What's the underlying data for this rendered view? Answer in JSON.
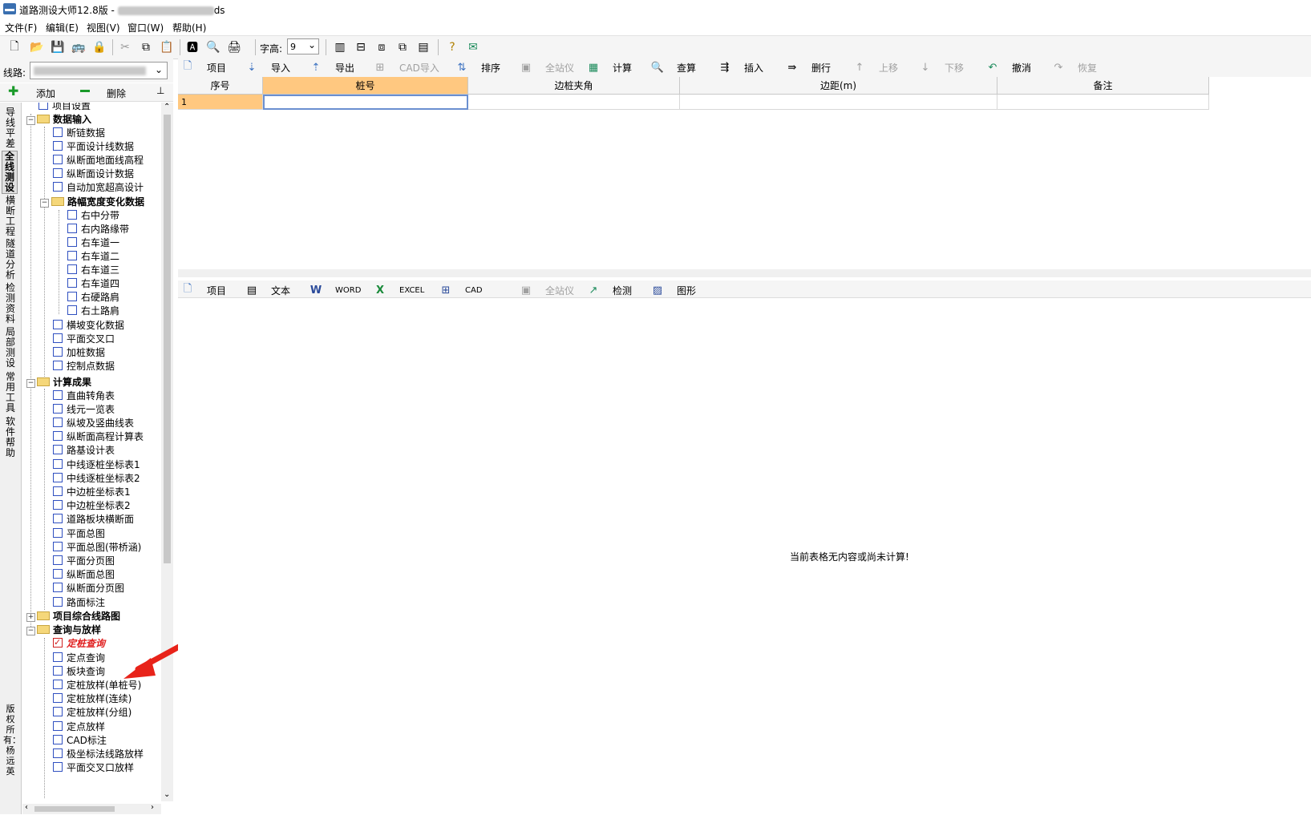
{
  "window": {
    "title": "道路测设大师12.8版 - ",
    "title_suffix": "ds"
  },
  "menu": [
    "文件(F)",
    "编辑(E)",
    "视图(V)",
    "窗口(W)",
    "帮助(H)"
  ],
  "toolbar": {
    "fontsize_label": "字高:",
    "fontsize_value": "9"
  },
  "route": {
    "label": "线路:"
  },
  "tree_actions": {
    "add": "添加",
    "delete": "删除"
  },
  "vtabs": [
    "导线平差",
    "全线测设",
    "横断工程",
    "隧道分析",
    "检测资料",
    "局部测设",
    "常用工具",
    "软件帮助",
    "版权所有：杨远英"
  ],
  "tree": {
    "project_settings": "项目设置",
    "data_input": {
      "label": "数据输入",
      "items": [
        "断链数据",
        "平面设计线数据",
        "纵断面地面线高程",
        "纵断面设计数据",
        "自动加宽超高设计"
      ]
    },
    "width_change": {
      "label": "路幅宽度变化数据",
      "items": [
        "右中分带",
        "右内路缘带",
        "右车道一",
        "右车道二",
        "右车道三",
        "右车道四",
        "右硬路肩",
        "右土路肩"
      ]
    },
    "data_input_more": [
      "横坡变化数据",
      "平面交叉口",
      "加桩数据",
      "控制点数据"
    ],
    "results": {
      "label": "计算成果",
      "items": [
        "直曲转角表",
        "线元一览表",
        "纵坡及竖曲线表",
        "纵断面高程计算表",
        "路基设计表",
        "中线逐桩坐标表1",
        "中线逐桩坐标表2",
        "中边桩坐标表1",
        "中边桩坐标表2",
        "道路板块横断面",
        "平面总图",
        "平面总图(带桥涵)",
        "平面分页图",
        "纵断面总图",
        "纵断面分页图",
        "路面标注"
      ]
    },
    "route_map": {
      "label": "项目综合线路图"
    },
    "query": {
      "label": "查询与放样",
      "selected": "定桩查询",
      "items": [
        "定点查询",
        "板块查询",
        "定桩放样(单桩号)",
        "定桩放样(连续)",
        "定桩放样(分组)",
        "定点放样",
        "CAD标注",
        "极坐标法线路放样",
        "平面交叉口放样"
      ]
    }
  },
  "grid_toolbar": [
    {
      "label": "项目",
      "icon": "doc-icon",
      "enabled": true
    },
    {
      "label": "导入",
      "icon": "import-icon",
      "enabled": true
    },
    {
      "label": "导出",
      "icon": "export-icon",
      "enabled": true
    },
    {
      "label": "CAD导入",
      "icon": "cad-icon",
      "enabled": false
    },
    {
      "label": "排序",
      "icon": "sort-icon",
      "enabled": true
    },
    {
      "label": "全站仪",
      "icon": "totalstation-icon",
      "enabled": false
    },
    {
      "label": "计算",
      "icon": "calc-icon",
      "enabled": true
    },
    {
      "label": "查算",
      "icon": "search-icon",
      "enabled": true
    },
    {
      "label": "插入",
      "icon": "insert-icon",
      "enabled": true
    },
    {
      "label": "删行",
      "icon": "delete-row-icon",
      "enabled": true
    },
    {
      "label": "上移",
      "icon": "up-arrow-icon",
      "enabled": false
    },
    {
      "label": "下移",
      "icon": "down-arrow-icon",
      "enabled": false
    },
    {
      "label": "撤消",
      "icon": "undo-icon",
      "enabled": true
    },
    {
      "label": "恢复",
      "icon": "redo-icon",
      "enabled": false
    }
  ],
  "grid": {
    "columns": [
      "序号",
      "桩号",
      "边桩夹角",
      "边距(m)",
      "备注"
    ],
    "rows": [
      [
        "1",
        "",
        "",
        "",
        ""
      ]
    ]
  },
  "result_toolbar": [
    {
      "label": "项目",
      "icon": "doc-icon",
      "enabled": true
    },
    {
      "label": "文本",
      "icon": "text-icon",
      "enabled": true
    },
    {
      "label": "WORD",
      "icon": "word-icon",
      "enabled": true
    },
    {
      "label": "EXCEL",
      "icon": "excel-icon",
      "enabled": true
    },
    {
      "label": "CAD",
      "icon": "cad-icon",
      "enabled": true
    },
    {
      "label": "全站仪",
      "icon": "totalstation-icon",
      "enabled": false
    },
    {
      "label": "检测",
      "icon": "chart-icon",
      "enabled": true
    },
    {
      "label": "图形",
      "icon": "image-icon",
      "enabled": true
    }
  ],
  "result": {
    "empty_message": "当前表格无内容或尚未计算!"
  }
}
